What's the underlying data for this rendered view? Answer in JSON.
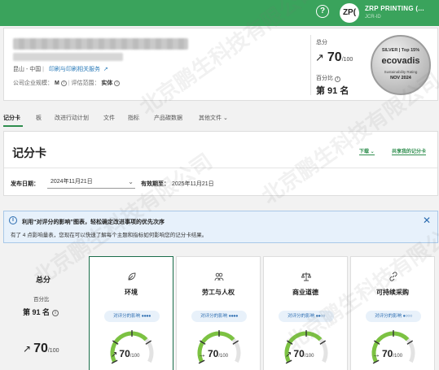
{
  "header": {
    "help_icon_glyph": "?",
    "avatar_initials": "ZP(",
    "company_name": "ZRP PRINTING (...",
    "company_sub": "JCR-ID"
  },
  "profile": {
    "location": "昆山 - 中国",
    "industry_link": "印刷与印刷相关服务",
    "size_label": "公司企业规模：",
    "size_value": "M",
    "scope_label": "评估范围：",
    "scope_value": "实体",
    "score_label": "总分",
    "score_value": "70",
    "score_denominator": "/100",
    "percentile_label": "百分比",
    "percentile_value": "第 91 名",
    "medal": {
      "line1": "SILVER | Top 15%",
      "brand": "ecovadis",
      "line3": "Sustainability Rating",
      "date": "NOV 2024"
    }
  },
  "tabs": [
    "记分卡",
    "板",
    "改进行动计划",
    "文件",
    "指标",
    "产品碳数据",
    "其他文件"
  ],
  "scorecard": {
    "title": "记分卡",
    "download": "下载",
    "share": "共享我的记分卡",
    "published_label": "发布日期：",
    "published_value": "2024年11月21日",
    "valid_label": "有效期至：",
    "valid_value": "2025年11月21日"
  },
  "banner": {
    "title": "利用“对评分的影响”图表，轻松确定改进事项的优先次序",
    "text": "有了 4 点影响量表，您现在可以快速了解每个主题和指标如何影响您的记分卡结果。"
  },
  "overall": {
    "label": "总分",
    "percentile_label": "百分比",
    "rank": "第 91 名",
    "score": "70",
    "denominator": "/100"
  },
  "themes": [
    {
      "name": "环境",
      "impact_label": "对评分的影响",
      "impact_level": 4,
      "impact_dots": "●●●●",
      "score": "70",
      "denominator": "/100",
      "trend": "up",
      "arrow": "↗",
      "icon": "leaf-icon"
    },
    {
      "name": "劳工与人权",
      "impact_label": "对评分的影响",
      "impact_level": 4,
      "impact_dots": "●●●●",
      "score": "70",
      "denominator": "/100",
      "trend": "flat",
      "arrow": "→",
      "icon": "people-icon"
    },
    {
      "name": "商业道德",
      "impact_label": "对评分的影响",
      "impact_level": 2,
      "impact_dots": "●●○○",
      "score": "70",
      "denominator": "/100",
      "trend": "up",
      "arrow": "↗",
      "icon": "scales-icon"
    },
    {
      "name": "可持续采购",
      "impact_label": "对评分的影响",
      "impact_level": 1,
      "impact_dots": "●○○○",
      "score": "70",
      "denominator": "/100",
      "trend": "flat",
      "arrow": "→",
      "icon": "link-icon"
    }
  ],
  "colors": {
    "brand_green": "#3aa35c",
    "accent_blue": "#2b6cb0",
    "gauge_track": "#e3e3e3",
    "gauge_fill": "#7cc242"
  },
  "watermark": "北京鹏生科技有限公司"
}
